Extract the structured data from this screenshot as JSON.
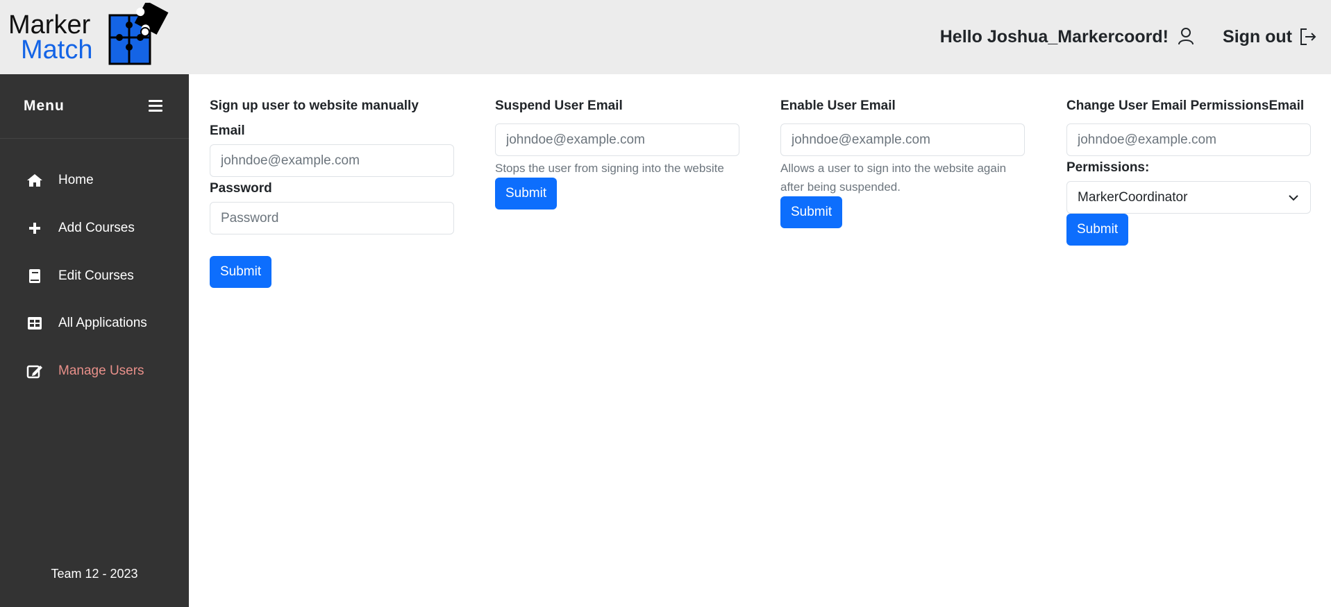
{
  "header": {
    "logo_line1": "Marker",
    "logo_line2": "Match",
    "greeting": "Hello Joshua_Markercoord!",
    "signout": "Sign out"
  },
  "sidebar": {
    "title": "Menu",
    "items": [
      {
        "label": "Home",
        "icon": "home-icon"
      },
      {
        "label": "Add Courses",
        "icon": "plus-icon"
      },
      {
        "label": "Edit Courses",
        "icon": "book-icon"
      },
      {
        "label": "All Applications",
        "icon": "table-icon"
      },
      {
        "label": "Manage Users",
        "icon": "edit-icon",
        "active": true
      }
    ],
    "footer": "Team 12 - 2023"
  },
  "signup": {
    "title": "Sign up user to website manually",
    "email_label": "Email",
    "email_placeholder": "johndoe@example.com",
    "password_label": "Password",
    "password_placeholder": "Password",
    "submit": "Submit"
  },
  "suspend": {
    "title": "Suspend User Email",
    "email_placeholder": "johndoe@example.com",
    "help": "Stops the user from signing into the website",
    "submit": "Submit"
  },
  "enable": {
    "title": "Enable User Email",
    "email_placeholder": "johndoe@example.com",
    "help": "Allows a user to sign into the website again after being suspended.",
    "submit": "Submit"
  },
  "permissions": {
    "title": "Change User Email PermissionsEmail",
    "email_placeholder": "johndoe@example.com",
    "permissions_label": "Permissions:",
    "selected": "MarkerCoordinator",
    "submit": "Submit"
  },
  "colors": {
    "primary": "#0d6efd",
    "sidebar_bg": "#333333",
    "header_bg": "#ececec",
    "active_nav": "#e8908a",
    "logo_blue": "#1464e6"
  }
}
